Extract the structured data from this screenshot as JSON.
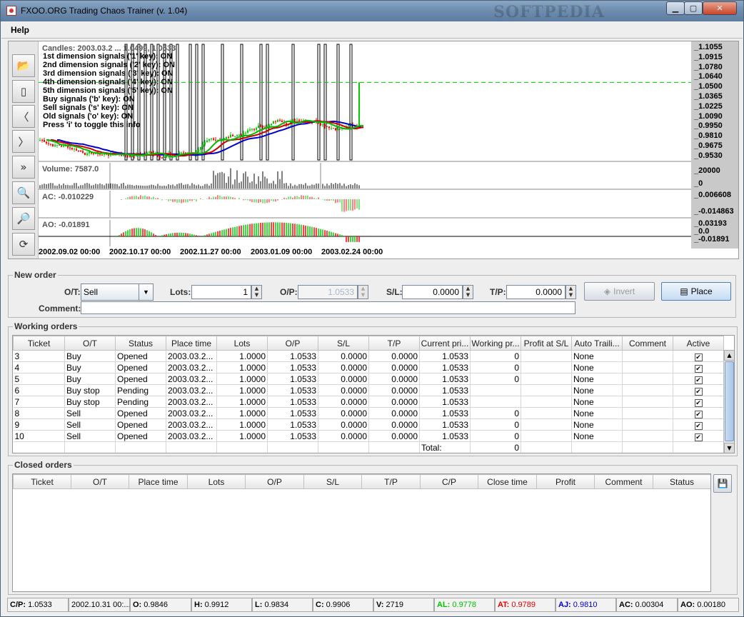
{
  "window": {
    "title": "FXOO.ORG Trading Chaos Trainer (v. 1.04)",
    "watermark": "SOFTPEDIA",
    "min_label": "▁",
    "max_label": "▢",
    "close_label": "✕"
  },
  "menu": {
    "help": "Help"
  },
  "toolbar": {
    "icons": [
      "open-folder-icon",
      "document-icon",
      "step-back-icon",
      "step-forward-icon",
      "fast-forward-icon",
      "zoom-out-icon",
      "zoom-in-icon",
      "refresh-icon"
    ]
  },
  "chart": {
    "candles_label": "Candles: 2003.03.2 ... 1.0499, 1.0533",
    "overlay_lines": [
      "1st dimension signals ('1' key): ON",
      "2nd dimension signals ('2' key): ON",
      "3rd dimension signals ('3' key): ON",
      "4th dimension signals ('4' key): ON",
      "5th dimension signals ('5' key): ON",
      "Buy signals ('b' key): ON",
      "Sell signals ('s' key): ON",
      "Old signals ('o' key): ON",
      "Press 'i' to toggle this info"
    ],
    "price_ticks": [
      "1.1055",
      "1.0915",
      "1.0780",
      "1.0640",
      "1.0500",
      "1.0365",
      "1.0225",
      "1.0090",
      "0.9950",
      "0.9810",
      "0.9675",
      "0.9530"
    ],
    "volume_label": "Volume: 7587.0",
    "volume_ticks": [
      "20000",
      "0"
    ],
    "ac_label": "AC: -0.010229",
    "ac_ticks": [
      "0.006608",
      "-0.014863"
    ],
    "ao_label": "AO: -0.01891",
    "ao_ticks": [
      "0.03193",
      "0.0",
      "-0.01891"
    ],
    "dates": [
      "2002.09.02 00:00",
      "2002.10.17 00:00",
      "2002.11.27 00:00",
      "2003.01.09 00:00",
      "2003.02.24 00:00"
    ],
    "current_price": 1.0533,
    "colors": {
      "up": "#00cc00",
      "down": "#ff0000",
      "jaw": "#0000cc",
      "teeth": "#cc0000",
      "lips": "#00bb00"
    }
  },
  "new_order": {
    "title": "New order",
    "ot_label": "O/T:",
    "ot_value": "Sell",
    "lots_label": "Lots:",
    "lots_value": "1",
    "op_label": "O/P:",
    "op_value": "1.0533",
    "sl_label": "S/L:",
    "sl_value": "0.0000",
    "tp_label": "T/P:",
    "tp_value": "0.0000",
    "comment_label": "Comment:",
    "comment_value": "",
    "invert_label": "Invert",
    "place_label": "Place"
  },
  "working_orders": {
    "title": "Working orders",
    "columns": [
      "Ticket",
      "O/T",
      "Status",
      "Place time",
      "Lots",
      "O/P",
      "S/L",
      "T/P",
      "Current pri...",
      "Working pr...",
      "Profit at S/L",
      "Auto Traili...",
      "Comment",
      "Active"
    ],
    "rows": [
      [
        "3",
        "Buy",
        "Opened",
        "2003.03.2...",
        "1.0000",
        "1.0533",
        "0.0000",
        "0.0000",
        "1.0533",
        "0",
        "",
        "None",
        "",
        "✔"
      ],
      [
        "4",
        "Buy",
        "Opened",
        "2003.03.2...",
        "1.0000",
        "1.0533",
        "0.0000",
        "0.0000",
        "1.0533",
        "0",
        "",
        "None",
        "",
        "✔"
      ],
      [
        "5",
        "Buy",
        "Opened",
        "2003.03.2...",
        "1.0000",
        "1.0533",
        "0.0000",
        "0.0000",
        "1.0533",
        "0",
        "",
        "None",
        "",
        "✔"
      ],
      [
        "6",
        "Buy stop",
        "Pending",
        "2003.03.2...",
        "1.0000",
        "1.0533",
        "0.0000",
        "0.0000",
        "1.0533",
        "",
        "",
        "None",
        "",
        "✔"
      ],
      [
        "7",
        "Buy stop",
        "Pending",
        "2003.03.2...",
        "1.0000",
        "1.0533",
        "0.0000",
        "0.0000",
        "1.0533",
        "",
        "",
        "None",
        "",
        "✔"
      ],
      [
        "8",
        "Sell",
        "Opened",
        "2003.03.2...",
        "1.0000",
        "1.0533",
        "0.0000",
        "0.0000",
        "1.0533",
        "0",
        "",
        "None",
        "",
        "✔"
      ],
      [
        "9",
        "Sell",
        "Opened",
        "2003.03.2...",
        "1.0000",
        "1.0533",
        "0.0000",
        "0.0000",
        "1.0533",
        "0",
        "",
        "None",
        "",
        "✔"
      ],
      [
        "10",
        "Sell",
        "Opened",
        "2003.03.2...",
        "1.0000",
        "1.0533",
        "0.0000",
        "0.0000",
        "1.0533",
        "0",
        "",
        "None",
        "",
        "✔"
      ]
    ],
    "total_label": "Total:",
    "total_value": "0"
  },
  "closed_orders": {
    "title": "Closed orders",
    "columns": [
      "Ticket",
      "O/T",
      "Place time",
      "Lots",
      "O/P",
      "S/L",
      "T/P",
      "C/P",
      "Close time",
      "Profit",
      "Comment",
      "Status"
    ],
    "save_icon": "save-icon"
  },
  "status": {
    "cp_label": "C/P:",
    "cp_value": "1.0533",
    "date_value": "2002.10.31 00:...",
    "o_label": "O:",
    "o_value": "0.9846",
    "h_label": "H:",
    "h_value": "0.9912",
    "l_label": "L:",
    "l_value": "0.9834",
    "c_label": "C:",
    "c_value": "0.9906",
    "v_label": "V:",
    "v_value": "2719",
    "al_label": "AL:",
    "al_value": "0.9778",
    "at_label": "AT:",
    "at_value": "0.9789",
    "aj_label": "AJ:",
    "aj_value": "0.9810",
    "ac_label": "AC:",
    "ac_value": "0.00304",
    "ao_label": "AO:",
    "ao_value": "0.00180"
  }
}
